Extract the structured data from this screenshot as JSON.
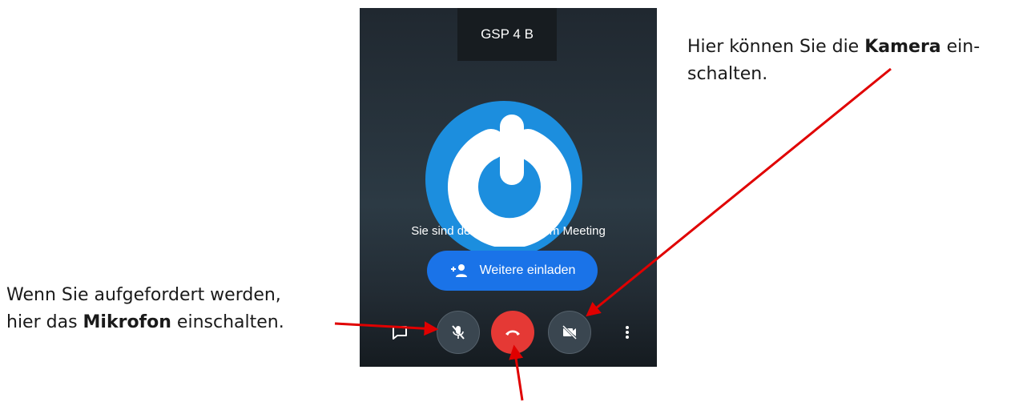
{
  "meeting": {
    "title": "GSP 4 B",
    "status_text": "Sie sind der erste in diesem Meeting",
    "invite_label": "Weitere einladen"
  },
  "annotations": {
    "camera": {
      "prefix": "Hier können Sie die ",
      "bold": "Kamera",
      "suffix_line1": " ein-",
      "line2": "schalten."
    },
    "mic": {
      "line1": "Wenn Sie aufgefordert werden,",
      "prefix": "hier das ",
      "bold": "Mikrofon",
      "suffix": " einschalten."
    }
  },
  "icons": {
    "chat": "chat-icon",
    "mic": "mic-off-icon",
    "hangup": "call-end-icon",
    "camera": "camera-off-icon",
    "more": "more-vert-icon",
    "invite": "person-add-icon"
  },
  "colors": {
    "hangup": "#e53935",
    "invite": "#1a73e8",
    "avatar": "#1c8ede",
    "arrow": "#e00000"
  }
}
